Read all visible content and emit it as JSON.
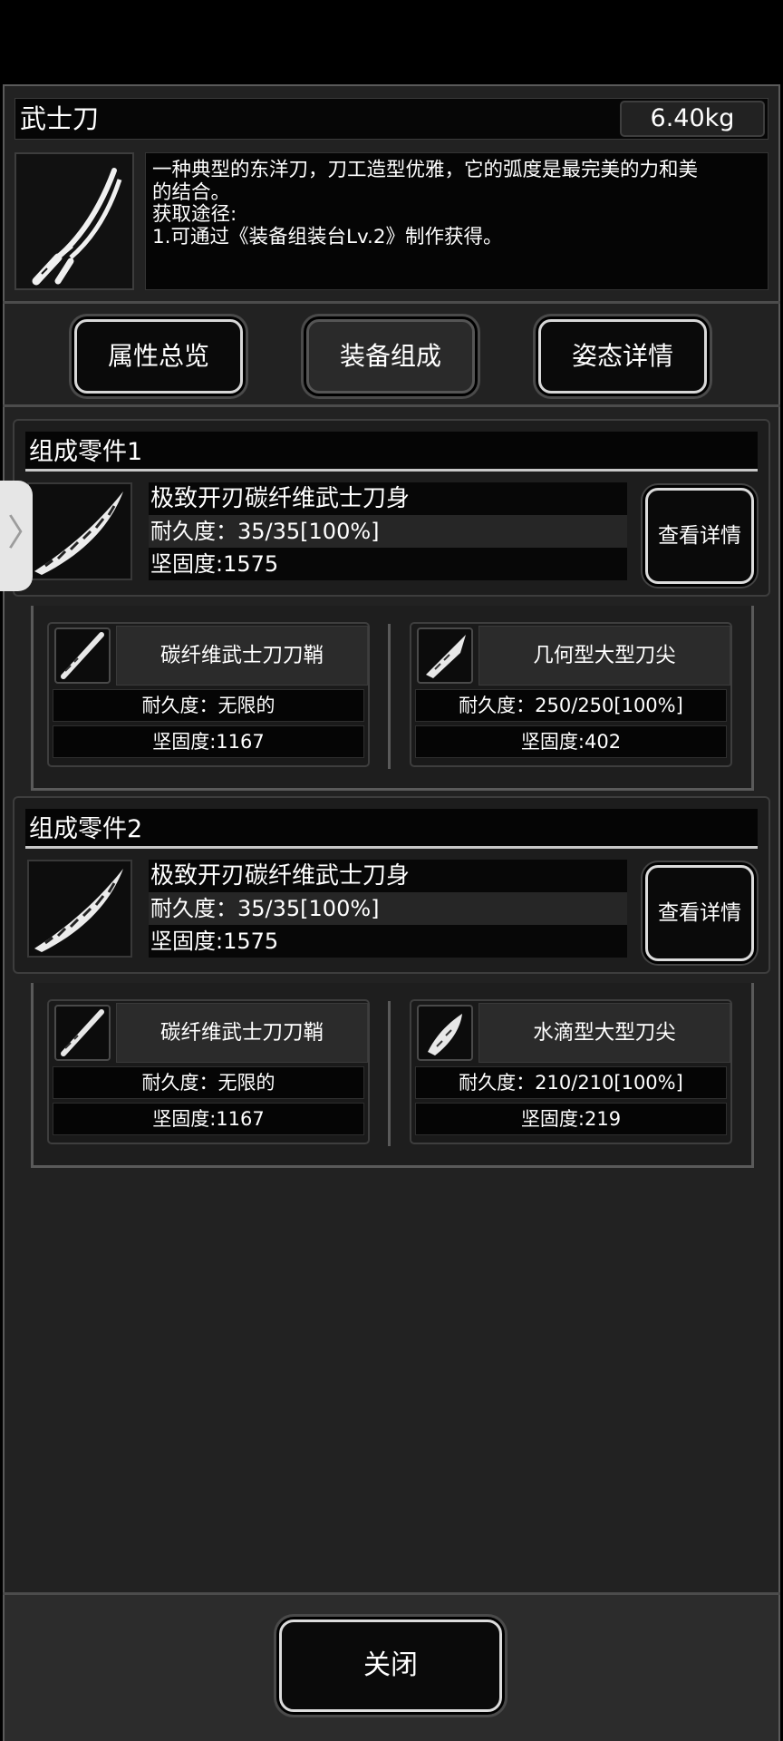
{
  "item": {
    "name": "武士刀",
    "weight": "6.40kg",
    "icon": "katana-icon",
    "description": [
      "一种典型的东洋刀，刀工造型优雅，它的弧度是最完美的力和美",
      "的结合。",
      "获取途径:",
      "1.可通过《装备组装台Lv.2》制作获得。"
    ]
  },
  "tabs": [
    {
      "label": "属性总览",
      "active": false
    },
    {
      "label": "装备组成",
      "active": true
    },
    {
      "label": "姿态详情",
      "active": false
    }
  ],
  "components": [
    {
      "title": "组成零件1",
      "part": {
        "name": "极致开刃碳纤维武士刀身",
        "durability": "耐久度：35/35[100%]",
        "hardness": "坚固度:1575",
        "icon": "blade-icon"
      },
      "detail_label": "查看详情",
      "subparts": [
        {
          "name": "碳纤维武士刀刀鞘",
          "durability": "耐久度：无限的",
          "hardness": "坚固度:1167",
          "icon": "scabbard-icon"
        },
        {
          "name": "几何型大型刀尖",
          "durability": "耐久度：250/250[100%]",
          "hardness": "坚固度:402",
          "icon": "blade-tip-icon"
        }
      ]
    },
    {
      "title": "组成零件2",
      "part": {
        "name": "极致开刃碳纤维武士刀身",
        "durability": "耐久度：35/35[100%]",
        "hardness": "坚固度:1575",
        "icon": "blade-icon"
      },
      "detail_label": "查看详情",
      "subparts": [
        {
          "name": "碳纤维武士刀刀鞘",
          "durability": "耐久度：无限的",
          "hardness": "坚固度:1167",
          "icon": "scabbard-icon"
        },
        {
          "name": "水滴型大型刀尖",
          "durability": "耐久度：210/210[100%]",
          "hardness": "坚固度:219",
          "icon": "blade-tip-icon"
        }
      ]
    }
  ],
  "side_handle": {
    "icon": "chevron-right-icon",
    "glyph": "〉"
  },
  "close_label": "关闭"
}
